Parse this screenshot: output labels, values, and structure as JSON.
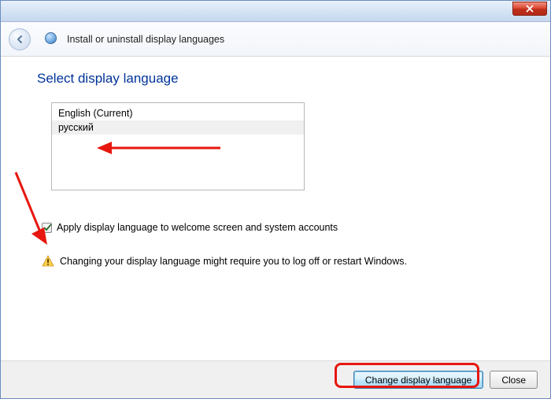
{
  "titlebar": {
    "close_aria": "Close"
  },
  "header": {
    "title": "Install or uninstall display languages"
  },
  "page": {
    "heading": "Select display language"
  },
  "languages": {
    "items": [
      {
        "label": "English (Current)"
      },
      {
        "label": "русский"
      }
    ]
  },
  "checkbox": {
    "checked": true,
    "label": "Apply display language to welcome screen and system accounts"
  },
  "warning": {
    "text": "Changing your display language might require you to log off or restart Windows."
  },
  "footer": {
    "primary": "Change display language",
    "close": "Close"
  }
}
